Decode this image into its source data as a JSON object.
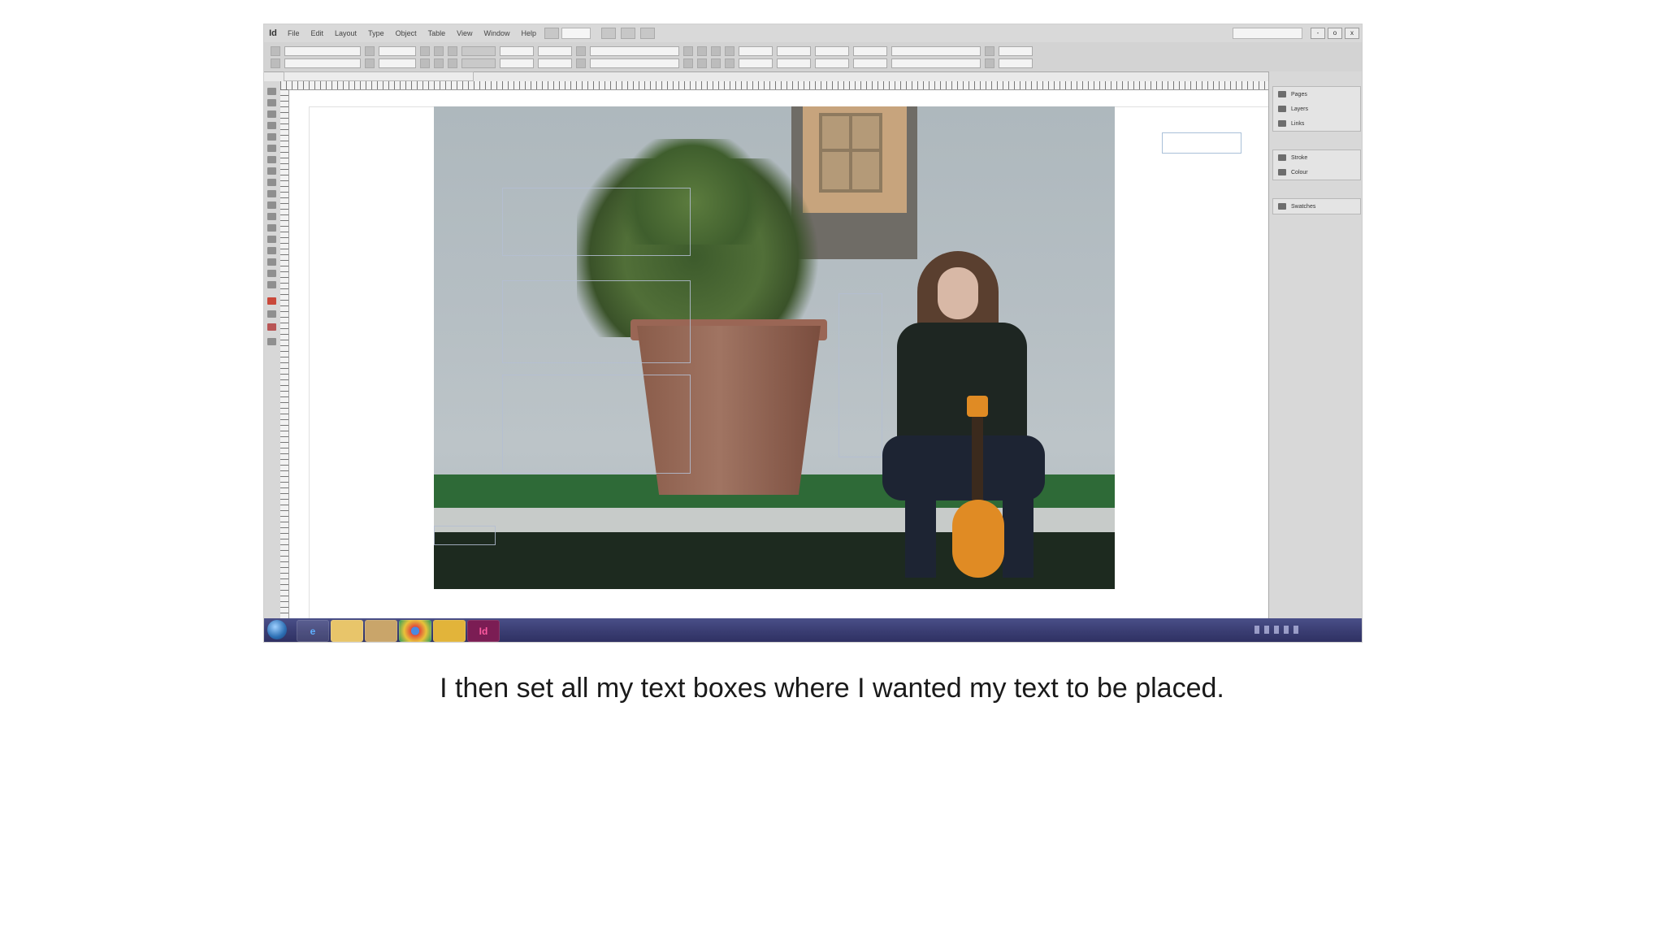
{
  "app": {
    "logo": "Id",
    "menu": [
      "File",
      "Edit",
      "Layout",
      "Type",
      "Object",
      "Table",
      "View",
      "Window",
      "Help"
    ],
    "zoom": "",
    "workspace": "",
    "window_controls": [
      "-",
      "o",
      "x"
    ]
  },
  "control_panel": {
    "font_family": "",
    "font_style": "",
    "font_size": "",
    "leading": "",
    "language": "",
    "paragraph_style": ""
  },
  "document_tab": {
    "title": ""
  },
  "panels": {
    "group_1": [
      "Pages",
      "Layers",
      "Links"
    ],
    "group_2": [
      "Stroke",
      "Colour"
    ],
    "group_3": [
      "Swatches"
    ]
  },
  "status": {
    "page": "",
    "preflight": ""
  },
  "taskbar": {
    "apps": [
      "ie-icon",
      "explorer-icon",
      "media-player-icon",
      "chrome-icon",
      "folder-icon",
      "indesign-icon"
    ],
    "indesign_label": "Id",
    "time": "",
    "date": ""
  },
  "colors": {
    "accent_indesign": "#7b1d54",
    "taskbar": "#3a3d72",
    "ukulele": "#e08b24"
  },
  "caption": "I then set all my text boxes where I wanted my text to be placed."
}
